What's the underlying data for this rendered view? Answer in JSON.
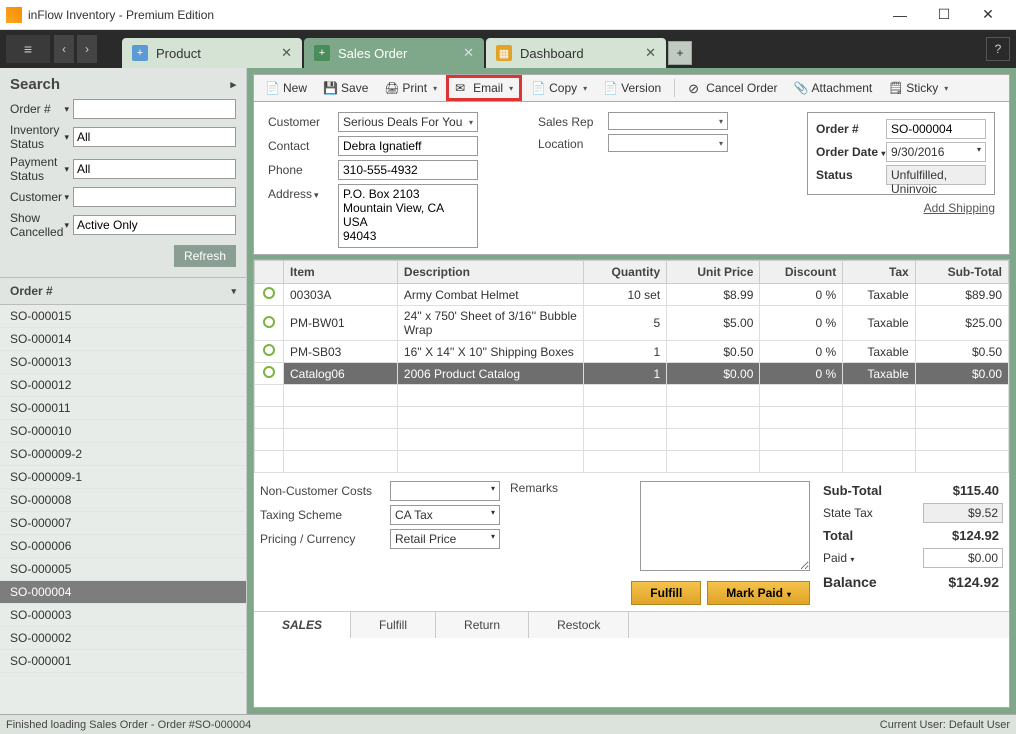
{
  "app": {
    "title": "inFlow Inventory - Premium Edition"
  },
  "tabs": [
    {
      "label": "Product",
      "active": false
    },
    {
      "label": "Sales Order",
      "active": true
    },
    {
      "label": "Dashboard",
      "active": false
    }
  ],
  "toolbar": {
    "new": "New",
    "save": "Save",
    "print": "Print",
    "email": "Email",
    "copy": "Copy",
    "version": "Version",
    "cancel": "Cancel Order",
    "attachment": "Attachment",
    "sticky": "Sticky"
  },
  "highlight": "email",
  "search": {
    "title": "Search",
    "fields": {
      "order_label": "Order #",
      "order_value": "",
      "inv_label": "Inventory Status",
      "inv_value": "All",
      "pay_label": "Payment Status",
      "pay_value": "All",
      "cust_label": "Customer",
      "cust_value": "",
      "canc_label": "Show Cancelled",
      "canc_value": "Active Only"
    },
    "refresh": "Refresh"
  },
  "sidebar": {
    "header": "Order #",
    "items": [
      "SO-000015",
      "SO-000014",
      "SO-000013",
      "SO-000012",
      "SO-000011",
      "SO-000010",
      "SO-000009-2",
      "SO-000009-1",
      "SO-000008",
      "SO-000007",
      "SO-000006",
      "SO-000005",
      "SO-000004",
      "SO-000003",
      "SO-000002",
      "SO-000001"
    ],
    "selected": "SO-000004"
  },
  "form": {
    "customer_label": "Customer",
    "customer": "Serious Deals For You",
    "contact_label": "Contact",
    "contact": "Debra Ignatieff",
    "phone_label": "Phone",
    "phone": "310-555-4932",
    "address_label": "Address",
    "address": "P.O. Box 2103\nMountain View, CA\nUSA\n94043",
    "salesrep_label": "Sales Rep",
    "salesrep": "",
    "location_label": "Location",
    "location": "",
    "meta": {
      "order_label": "Order #",
      "order": "SO-000004",
      "date_label": "Order Date",
      "date": "9/30/2016",
      "status_label": "Status",
      "status": "Unfulfilled, Uninvoic"
    },
    "add_shipping": "Add Shipping"
  },
  "grid": {
    "headers": {
      "item": "Item",
      "desc": "Description",
      "qty": "Quantity",
      "price": "Unit Price",
      "disc": "Discount",
      "tax": "Tax",
      "sub": "Sub-Total"
    },
    "rows": [
      {
        "item": "00303A",
        "desc": "Army Combat Helmet",
        "qty": "10 set",
        "price": "$8.99",
        "disc": "0 %",
        "tax": "Taxable",
        "sub": "$89.90"
      },
      {
        "item": "PM-BW01",
        "desc": "24'' x 750' Sheet of 3/16'' Bubble Wrap",
        "qty": "5",
        "price": "$5.00",
        "disc": "0 %",
        "tax": "Taxable",
        "sub": "$25.00"
      },
      {
        "item": "PM-SB03",
        "desc": "16'' X 14'' X 10'' Shipping Boxes",
        "qty": "1",
        "price": "$0.50",
        "disc": "0 %",
        "tax": "Taxable",
        "sub": "$0.50"
      },
      {
        "item": "Catalog06",
        "desc": "2006 Product Catalog",
        "qty": "1",
        "price": "$0.00",
        "disc": "0 %",
        "tax": "Taxable",
        "sub": "$0.00"
      }
    ],
    "selected_index": 3
  },
  "bottom": {
    "ncc_label": "Non-Customer Costs",
    "ncc": "",
    "scheme_label": "Taxing Scheme",
    "scheme": "CA Tax",
    "pricing_label": "Pricing / Currency",
    "pricing": "Retail Price",
    "remarks_label": "Remarks",
    "remarks": "",
    "fulfill": "Fulfill",
    "markpaid": "Mark Paid"
  },
  "totals": {
    "subtotal_label": "Sub-Total",
    "subtotal": "$115.40",
    "tax_label": "State Tax",
    "tax": "$9.52",
    "total_label": "Total",
    "total": "$124.92",
    "paid_label": "Paid",
    "paid": "$0.00",
    "balance_label": "Balance",
    "balance": "$124.92"
  },
  "subtabs": {
    "sales": "SALES",
    "fulfill": "Fulfill",
    "return": "Return",
    "restock": "Restock"
  },
  "status": {
    "left": "Finished loading Sales Order - Order #SO-000004",
    "right": "Current User:  Default User"
  }
}
